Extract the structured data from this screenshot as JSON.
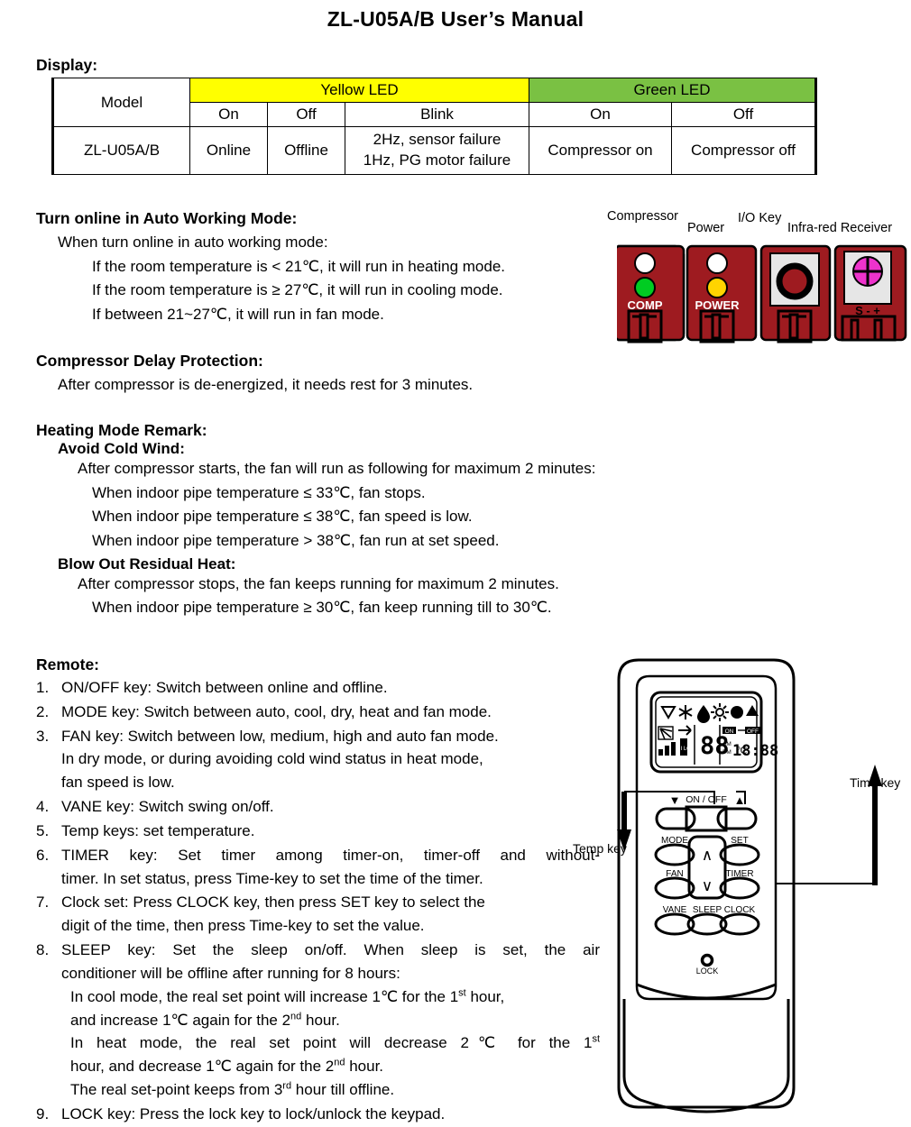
{
  "document": {
    "title": "ZL-U05A/B User’s Manual"
  },
  "display_section": {
    "heading": "Display:",
    "table": {
      "group_headers": [
        "Model",
        "Yellow LED",
        "Green LED"
      ],
      "sub_headers": [
        "On",
        "Off",
        "Blink",
        "On",
        "Off"
      ],
      "rows": [
        {
          "model": "ZL-U05A/B",
          "yellow_on": "Online",
          "yellow_off": "Offline",
          "yellow_blink_line1": "2Hz, sensor failure",
          "yellow_blink_line2": "1Hz, PG motor failure",
          "green_on": "Compressor on",
          "green_off": "Compressor off"
        }
      ],
      "colors": {
        "yellow": "#ffff00",
        "green": "#7ac143"
      }
    }
  },
  "auto_mode_section": {
    "heading": "Turn online in Auto Working Mode:",
    "intro": "When turn online in auto working mode:",
    "rules": [
      "If the room temperature is < 21℃, it will run in heating mode.",
      "If the room temperature is ≥ 27℃, it will run in cooling mode.",
      "If between 21~27℃, it will run in fan mode."
    ]
  },
  "compressor_delay_section": {
    "heading": "Compressor Delay Protection:",
    "body": "After compressor is de-energized, it needs rest for 3 minutes."
  },
  "heating_remark_section": {
    "heading": "Heating Mode Remark:",
    "avoid_cold_wind": {
      "heading": "Avoid Cold Wind:",
      "intro": "After compressor starts, the fan will run as following for maximum 2 minutes:",
      "rules": [
        "When indoor pipe temperature ≤ 33℃, fan stops.",
        "When indoor pipe temperature ≤ 38℃, fan speed is low.",
        "When indoor pipe temperature > 38℃, fan run at set speed."
      ]
    },
    "blow_out_residual_heat": {
      "heading": "Blow Out Residual Heat:",
      "intro": "After compressor stops, the fan keeps running for maximum 2 minutes.",
      "rules": [
        "When indoor pipe temperature ≥ 30℃, fan keep running till to 30℃."
      ]
    }
  },
  "remote_section": {
    "heading": "Remote:",
    "items": [
      {
        "num": "1.",
        "lines": [
          "ON/OFF key: Switch between online and offline."
        ]
      },
      {
        "num": "2.",
        "lines": [
          "MODE key: Switch between auto, cool, dry, heat and fan mode."
        ]
      },
      {
        "num": "3.",
        "lines": [
          "FAN key: Switch between low, medium, high and auto fan mode.",
          "In dry mode, or during avoiding cold wind status in heat mode,",
          "fan speed is low."
        ]
      },
      {
        "num": "4.",
        "lines": [
          "VANE key: Switch swing on/off."
        ]
      },
      {
        "num": "5.",
        "lines": [
          "Temp keys: set temperature."
        ]
      },
      {
        "num": "6.",
        "lines": [
          "TIMER key: Set timer among timer-on, timer-off and without-",
          "timer. In set status, press Time-key to set the time of the timer."
        ]
      },
      {
        "num": "7.",
        "lines": [
          "Clock set: Press CLOCK key, then press SET key to select the",
          "digit of the time, then press Time-key to set the value."
        ]
      },
      {
        "num": "8.",
        "lines": [
          "SLEEP key: Set the sleep on/off. When sleep is set, the air",
          "conditioner will be offline after running for 8 hours:"
        ],
        "sub_lines_html": [
          "In cool mode, the real set point will increase 1℃ for the 1<sup>st</sup> hour,",
          "and increase 1℃ again for the 2<sup>nd</sup> hour.",
          "In heat mode, the real set point will decrease 2℃ for the 1<sup>st</sup>",
          "hour, and decrease 1℃ again for the 2<sup>nd</sup> hour.",
          "The real set-point keeps from 3<sup>rd</sup> hour till offline."
        ]
      },
      {
        "num": "9.",
        "lines": [
          "LOCK key: Press the lock key to lock/unlock the keypad."
        ]
      }
    ]
  },
  "pcb_diagram": {
    "labels": {
      "compressor": "Compressor",
      "power": "Power",
      "io_key": "I/O Key",
      "ir_receiver": "Infra-red Receiver"
    },
    "block_labels": {
      "comp": "COMP",
      "power": "POWER",
      "ir_pins": "S  -  +"
    },
    "colors": {
      "board": "#9e1b20",
      "board_light": "#b92026",
      "led_comp": "#00cc22",
      "led_power": "#ffd400",
      "led_blank": "#ffffff",
      "ir_window": "#e6e6e6",
      "ir_dot": "#ee33cc",
      "key_face": "#e6e6e6"
    }
  },
  "remote_diagram": {
    "callouts": {
      "temp_key": "Temp key",
      "time_key": "Time key"
    },
    "lcd": {
      "mode_icons": [
        "auto-triangle-icon",
        "snowflake-icon",
        "droplet-icon",
        "sun-icon",
        "fan-circle-icon",
        "vane-triangle-icon"
      ],
      "swing_icon": "swing-icon",
      "fan-bars-icon": "fan-bars-icon",
      "hi_lo_label": "HI LO",
      "temp_value": "88",
      "temp_unit": "℃",
      "timer_on": "ON",
      "timer_off": "OFF",
      "am_label": "AM",
      "pm_label": "PM",
      "clock_value": "18:88"
    },
    "buttons": [
      {
        "label": "▼",
        "name": "temp-down-button"
      },
      {
        "label": "ON / OFF",
        "name": "on-off-button"
      },
      {
        "label": "▲",
        "name": "temp-up-button"
      },
      {
        "label": "MODE",
        "name": "mode-button"
      },
      {
        "label": "SET",
        "name": "set-button"
      },
      {
        "label": "FAN",
        "name": "fan-button"
      },
      {
        "label": "TIMER",
        "name": "timer-button"
      },
      {
        "label": "VANE",
        "name": "vane-button"
      },
      {
        "label": "SLEEP",
        "name": "sleep-button"
      },
      {
        "label": "CLOCK",
        "name": "clock-button"
      },
      {
        "label": "LOCK",
        "name": "lock-button"
      }
    ],
    "rocker": {
      "up": "∧",
      "down": "∨"
    }
  }
}
